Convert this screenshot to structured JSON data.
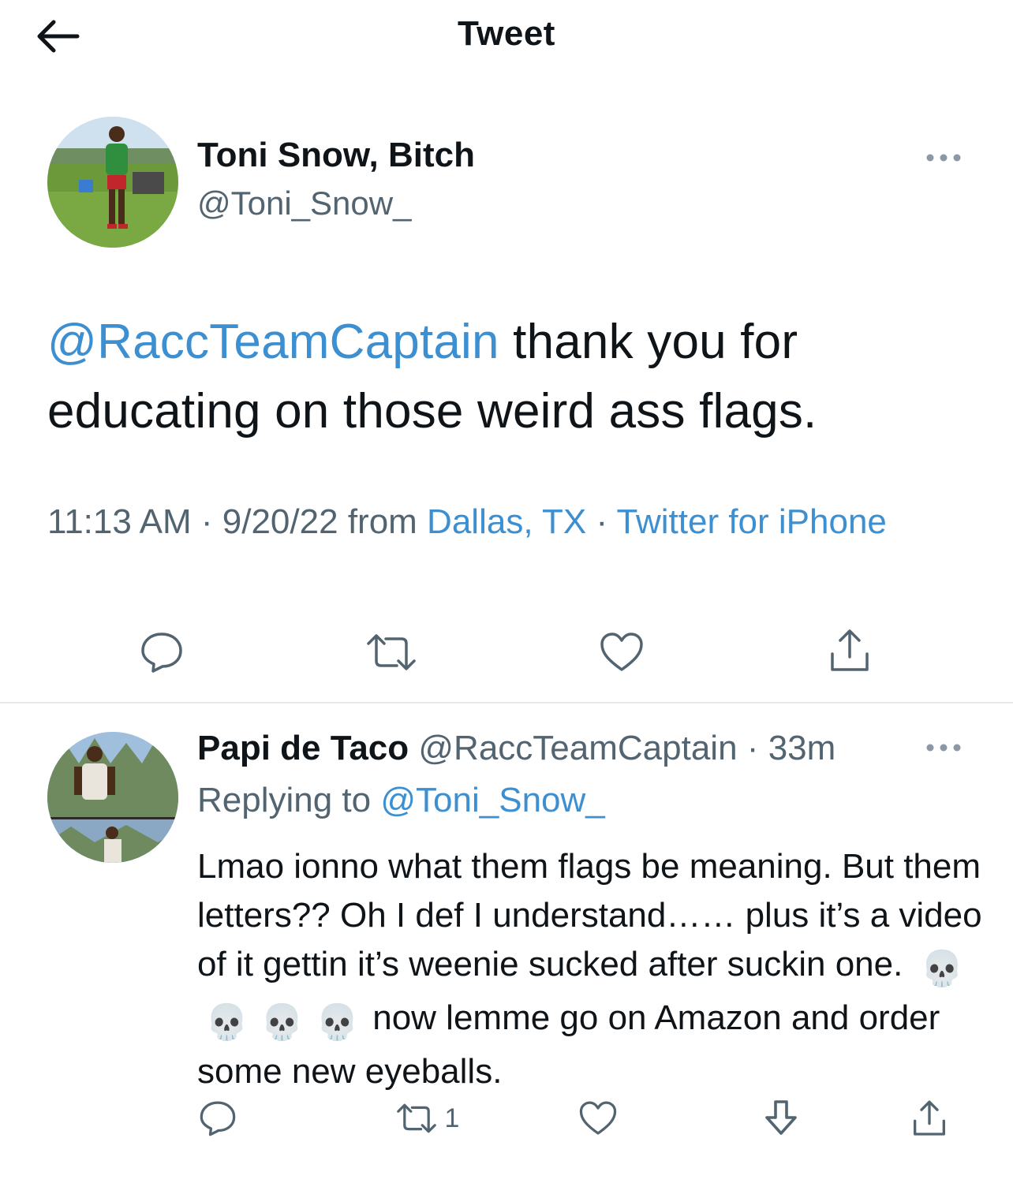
{
  "header": {
    "title": "Tweet",
    "back_icon": "arrow-left-icon"
  },
  "main_tweet": {
    "display_name": "Toni Snow, Bitch",
    "handle": "@Toni_Snow_",
    "mention": "@RaccTeamCaptain",
    "text": " thank you for educating on those weird ass flags.",
    "time": "11:13 AM",
    "date": "9/20/22",
    "from_label": "from",
    "location": "Dallas, TX",
    "separator": "·",
    "source": "Twitter for iPhone",
    "more_icon": "ellipsis-icon"
  },
  "reply_tweet": {
    "display_name": "Papi de Taco",
    "handle": "@RaccTeamCaptain",
    "separator": "·",
    "age": "33m",
    "replying_label": "Replying to",
    "replying_handle": "@Toni_Snow_",
    "text_before": "Lmao ionno what them flags be meaning. But them letters?? Oh I def I understand…… plus it’s a video of it gettin it’s weenie sucked after suckin one.",
    "emoji": "💀",
    "text_after": " now lemme go on Amazon and order some new eyeballs.",
    "retweet_count": "1"
  },
  "colors": {
    "link": "#3c8fd0",
    "text": "#0f1419",
    "muted": "#536471",
    "divider": "#e7e9ea"
  }
}
